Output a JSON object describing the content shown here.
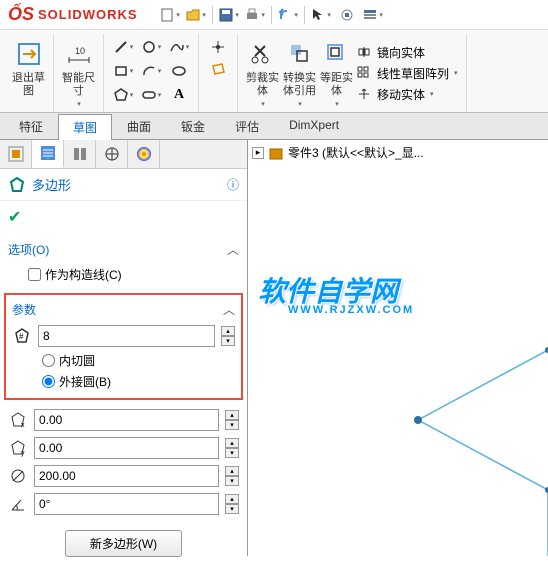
{
  "app": {
    "logo_prefix": "S",
    "logo_text": "SOLIDWORKS"
  },
  "ribbon": {
    "exit_sketch": "退出草\n图",
    "smart_dim": "智能尺\n寸",
    "trim": "剪裁实\n体",
    "convert": "转换实\n体引用",
    "offset": "等距实\n体",
    "mirror": "镜向实体",
    "linear_pattern": "线性草图阵列",
    "move": "移动实体"
  },
  "tabs": [
    "特征",
    "草图",
    "曲面",
    "钣金",
    "评估",
    "DimXpert"
  ],
  "active_tab": 1,
  "feature": {
    "title": "多边形",
    "options_label": "选项(O)",
    "construction_label": "作为构造线(C)",
    "params_label": "参数",
    "sides_value": "8",
    "inscribed_label": "内切圆",
    "circumscribed_label": "外接圆(B)",
    "x_value": "0.00",
    "y_value": "0.00",
    "diameter_value": "200.00",
    "angle_value": "0°",
    "new_button": "新多边形(W)"
  },
  "tree": {
    "part_label": "零件3  (默认<<默认>_显..."
  },
  "watermark": {
    "text": "软件自学网",
    "url": "WWW.RJZXW.COM"
  }
}
